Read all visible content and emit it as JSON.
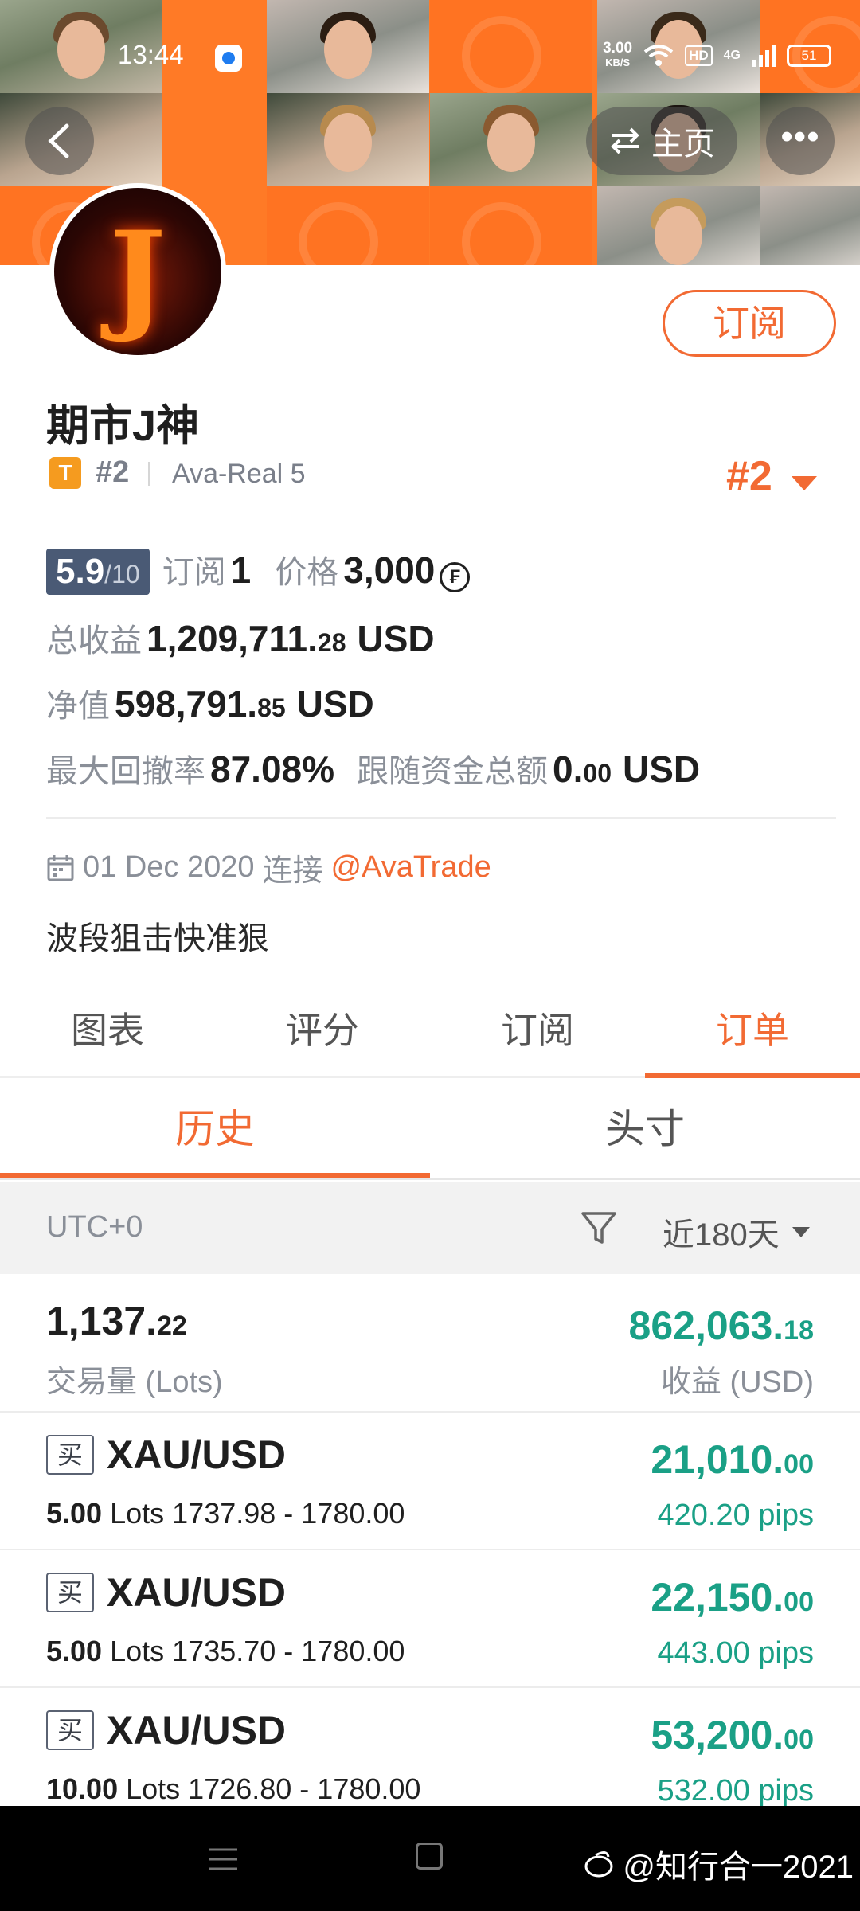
{
  "status_bar": {
    "time": "13:44",
    "net_speed_value": "3.00",
    "net_speed_unit": "KB/S",
    "hd": "HD",
    "signal": "4G",
    "battery": "51"
  },
  "header": {
    "home_label": "主页",
    "more_label": "•••"
  },
  "profile": {
    "avatar_letter": "J",
    "subscribe_label": "订阅",
    "name": "期市J神",
    "badge": "T",
    "rank_small": "#2",
    "account": "Ava-Real 5",
    "rank_big": "#2",
    "score": "5.9",
    "score_max": "/10",
    "subscribers_label": "订阅",
    "subscribers": "1",
    "price_label": "价格",
    "price": "3,000",
    "price_currency_symbol": "₣",
    "total_profit_label": "总收益",
    "total_profit_int": "1,209,711.",
    "total_profit_dec": "28",
    "total_profit_unit": "USD",
    "equity_label": "净值",
    "equity_int": "598,791.",
    "equity_dec": "85",
    "equity_unit": "USD",
    "max_drawdown_label": "最大回撤率",
    "max_drawdown": "87.08%",
    "follow_funds_label": "跟随资金总额",
    "follow_funds_int": "0.",
    "follow_funds_dec": "00",
    "follow_funds_unit": "USD",
    "join_date": "01 Dec 2020",
    "join_connector": "连接",
    "broker": "@AvaTrade",
    "bio": "波段狙击快准狠"
  },
  "tabs": [
    {
      "label": "图表",
      "active": false
    },
    {
      "label": "评分",
      "active": false
    },
    {
      "label": "订阅",
      "active": false
    },
    {
      "label": "订单",
      "active": true
    }
  ],
  "subtabs": [
    {
      "label": "历史",
      "active": true
    },
    {
      "label": "头寸",
      "active": false
    }
  ],
  "filter": {
    "timezone": "UTC+0",
    "period": "近180天"
  },
  "summary": {
    "volume_int": "1,137.",
    "volume_dec": "22",
    "volume_label": "交易量 (Lots)",
    "profit_int": "862,063.",
    "profit_dec": "18",
    "profit_label": "收益 (USD)"
  },
  "orders": [
    {
      "side": "买",
      "symbol": "XAU/USD",
      "lots": "5.00",
      "lots_unit": "Lots",
      "range": "1737.98 - 1780.00",
      "profit_int": "21,010.",
      "profit_dec": "00",
      "pips": "420.20 pips"
    },
    {
      "side": "买",
      "symbol": "XAU/USD",
      "lots": "5.00",
      "lots_unit": "Lots",
      "range": "1735.70 - 1780.00",
      "profit_int": "22,150.",
      "profit_dec": "00",
      "pips": "443.00 pips"
    },
    {
      "side": "买",
      "symbol": "XAU/USD",
      "lots": "10.00",
      "lots_unit": "Lots",
      "range": "1726.80 - 1780.00",
      "profit_int": "53,200.",
      "profit_dec": "00",
      "pips": "532.00 pips"
    }
  ],
  "watermark": "@知行合一2021",
  "colors": {
    "accent": "#f26a33",
    "profit_green": "#1aa086",
    "score_bg": "#4a5a75"
  }
}
